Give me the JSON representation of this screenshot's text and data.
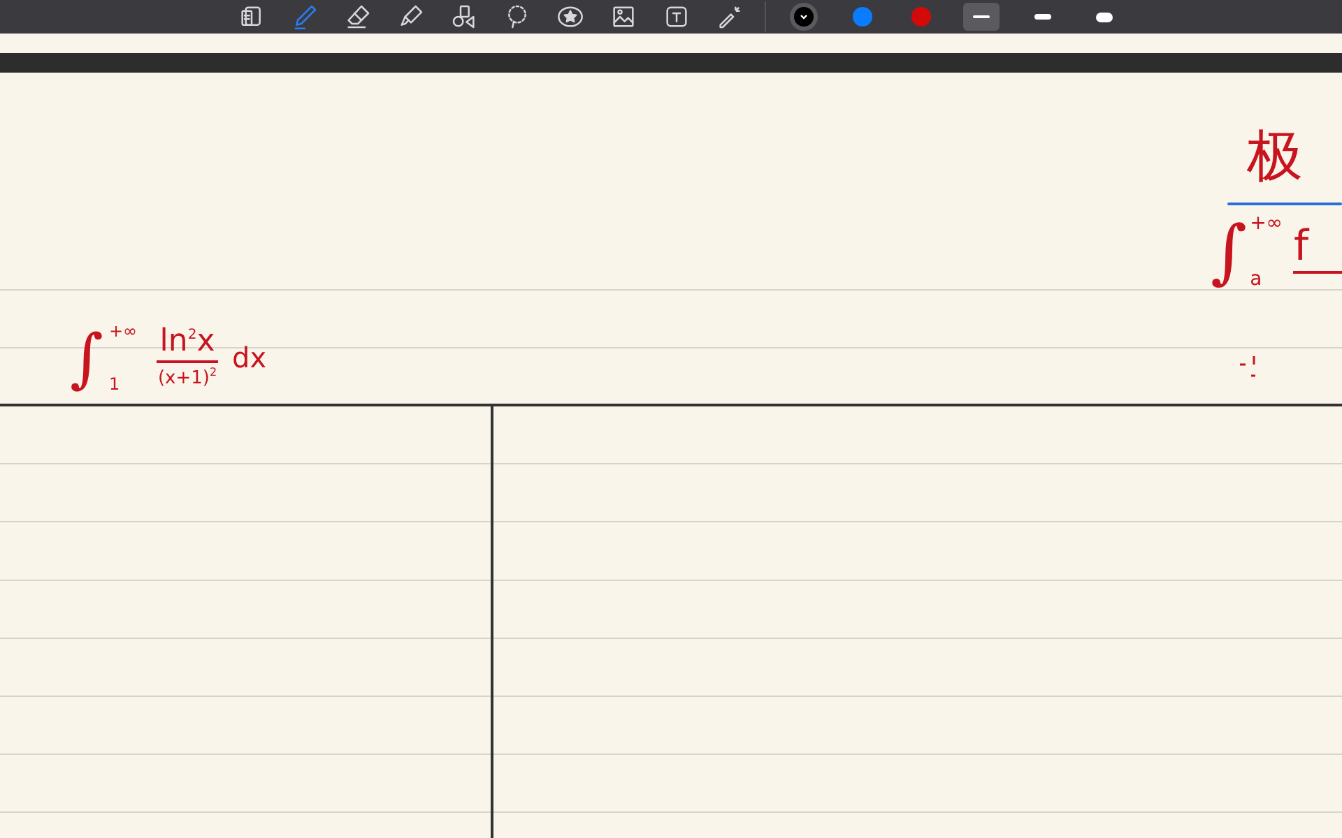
{
  "toolbar": {
    "tools": [
      {
        "kind": "pages",
        "selected": false
      },
      {
        "kind": "pen",
        "selected": true
      },
      {
        "kind": "eraser",
        "selected": false
      },
      {
        "kind": "highlighter",
        "selected": false
      },
      {
        "kind": "shapes",
        "selected": false
      },
      {
        "kind": "lasso",
        "selected": false
      },
      {
        "kind": "sticker",
        "selected": false
      },
      {
        "kind": "image",
        "selected": false
      },
      {
        "kind": "text",
        "selected": false
      },
      {
        "kind": "laser",
        "selected": false
      }
    ],
    "colors": [
      {
        "color": "#000000",
        "selected": true
      },
      {
        "color": "#0a7cff",
        "selected": false
      },
      {
        "color": "#d40a0a",
        "selected": false
      }
    ],
    "strokes": [
      {
        "kind": "thin",
        "selected": true
      },
      {
        "kind": "medium",
        "selected": false
      },
      {
        "kind": "thick",
        "selected": false
      }
    ]
  },
  "notes": [
    {
      "kind": "integral",
      "sign": "∫",
      "upper": "+∞",
      "lower": "1",
      "numerator": "ln$^{2}$x",
      "denominator": "(x+1)$^{2}$",
      "differential": "dx"
    },
    {
      "kind": "heading",
      "text": "极"
    },
    {
      "kind": "integral_partial",
      "sign": "∫",
      "upper": "+∞",
      "lower": "a",
      "numerator": "f"
    }
  ]
}
